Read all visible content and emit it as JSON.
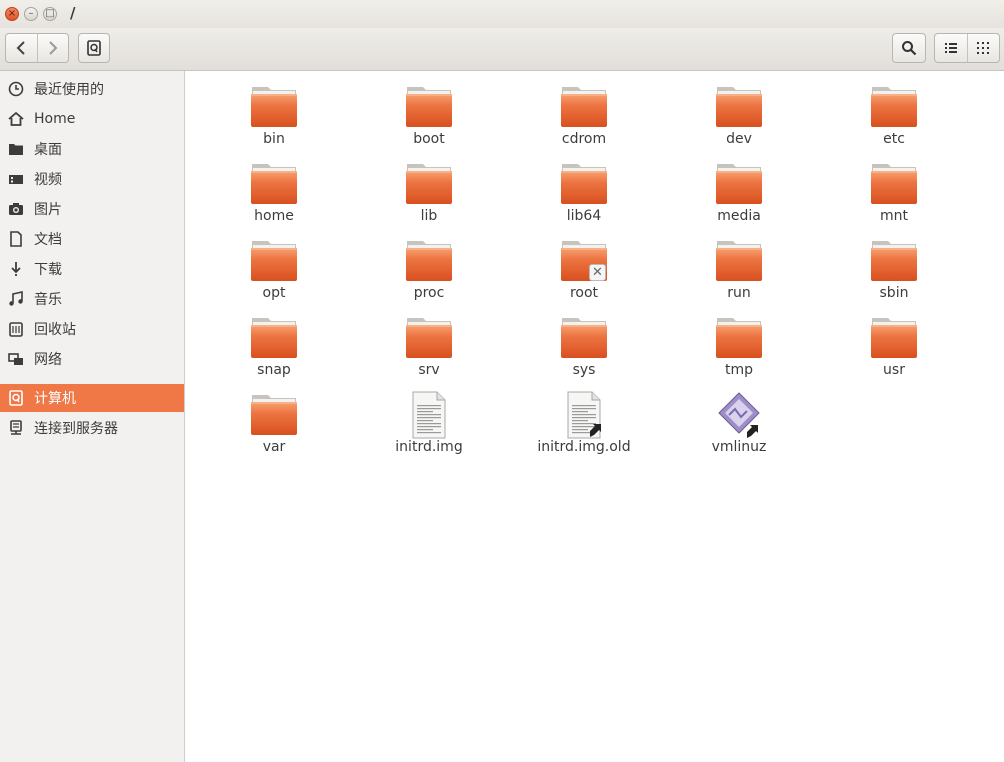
{
  "window": {
    "title": "/"
  },
  "toolbar": {
    "back_icon": "chevron-left-icon",
    "forward_icon": "chevron-right-icon",
    "location_icon": "drive-icon",
    "search_icon": "search-icon",
    "list_view_icon": "list-view-icon",
    "grid_view_icon": "grid-view-icon"
  },
  "sidebar": {
    "items": [
      {
        "label": "最近使用的",
        "icon": "recent-icon"
      },
      {
        "label": "Home",
        "icon": "home-icon"
      },
      {
        "label": "桌面",
        "icon": "desktop-folder-icon"
      },
      {
        "label": "视频",
        "icon": "video-icon"
      },
      {
        "label": "图片",
        "icon": "camera-icon"
      },
      {
        "label": "文档",
        "icon": "document-icon"
      },
      {
        "label": "下载",
        "icon": "download-icon"
      },
      {
        "label": "音乐",
        "icon": "music-icon"
      },
      {
        "label": "回收站",
        "icon": "trash-icon"
      },
      {
        "label": "网络",
        "icon": "network-icon"
      },
      {
        "label": "计算机",
        "icon": "computer-drive-icon",
        "selected": true
      },
      {
        "label": "连接到服务器",
        "icon": "server-icon"
      }
    ]
  },
  "files": [
    {
      "name": "bin",
      "type": "folder"
    },
    {
      "name": "boot",
      "type": "folder"
    },
    {
      "name": "cdrom",
      "type": "folder"
    },
    {
      "name": "dev",
      "type": "folder"
    },
    {
      "name": "etc",
      "type": "folder"
    },
    {
      "name": "home",
      "type": "folder"
    },
    {
      "name": "lib",
      "type": "folder"
    },
    {
      "name": "lib64",
      "type": "folder"
    },
    {
      "name": "media",
      "type": "folder"
    },
    {
      "name": "mnt",
      "type": "folder"
    },
    {
      "name": "opt",
      "type": "folder"
    },
    {
      "name": "proc",
      "type": "folder"
    },
    {
      "name": "root",
      "type": "folder-locked"
    },
    {
      "name": "run",
      "type": "folder"
    },
    {
      "name": "sbin",
      "type": "folder"
    },
    {
      "name": "snap",
      "type": "folder"
    },
    {
      "name": "srv",
      "type": "folder"
    },
    {
      "name": "sys",
      "type": "folder"
    },
    {
      "name": "tmp",
      "type": "folder"
    },
    {
      "name": "usr",
      "type": "folder"
    },
    {
      "name": "var",
      "type": "folder"
    },
    {
      "name": "initrd.img",
      "type": "text-file"
    },
    {
      "name": "initrd.img.old",
      "type": "text-file-link"
    },
    {
      "name": "vmlinuz",
      "type": "binary-link"
    }
  ],
  "colors": {
    "accent": "#f07746",
    "folder": "#e8622a"
  }
}
